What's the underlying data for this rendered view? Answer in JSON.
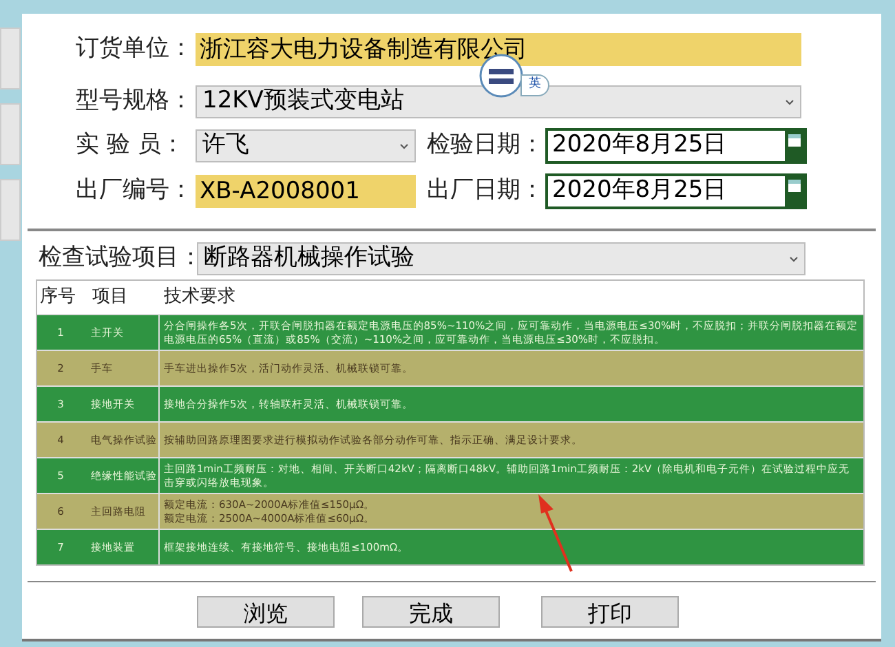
{
  "form": {
    "customer": {
      "label": "订货单位：",
      "value": "浙江容大电力设备制造有限公司"
    },
    "model": {
      "label": "型号规格：",
      "value": "12KV预装式变电站"
    },
    "tester": {
      "label": "实 验 员：",
      "value": "许飞"
    },
    "test_date": {
      "label": "检验日期：",
      "value": "2020年8月25日"
    },
    "serial": {
      "label": "出厂编号：",
      "value": "XB-A2008001"
    },
    "factory_date": {
      "label": "出厂日期：",
      "value": "2020年8月25日"
    }
  },
  "ime_badge": {
    "label": "英"
  },
  "test_item": {
    "label": "检查试验项目：",
    "value": "断路器机械操作试验"
  },
  "table": {
    "columns": [
      "序号",
      "项目",
      "技术要求"
    ],
    "rows": [
      {
        "no": "1",
        "item": "主开关",
        "color": "#2f9442",
        "lines": [
          "分合闸操作各5次，开联合闸脱扣器在额定电源电压的85%~110%之间，应可靠动作，当电源电压≤30%时，不应脱扣；并联分闸脱扣器在额定电源电压的65%（直流）或85%（交流）~110%之间，应可靠动作，当电源电压≤30%时，不应脱扣。"
        ]
      },
      {
        "no": "2",
        "item": "手车",
        "color": "#b5b06c",
        "lines": [
          "手车进出操作5次，活门动作灵活、机械联锁可靠。"
        ]
      },
      {
        "no": "3",
        "item": "接地开关",
        "color": "#2f9442",
        "lines": [
          "接地合分操作5次，转轴联杆灵活、机械联锁可靠。"
        ]
      },
      {
        "no": "4",
        "item": "电气操作试验",
        "color": "#b5b06c",
        "lines": [
          "按辅助回路原理图要求进行模拟动作试验各部分动作可靠、指示正确、满足设计要求。"
        ]
      },
      {
        "no": "5",
        "item": "绝缘性能试验",
        "color": "#2f9442",
        "lines": [
          "主回路1min工频耐压：对地、相间、开关断口42kV；隔离断口48kV。辅助回路1min工频耐压：2kV（除电机和电子元件）在试验过程中应无击穿或闪络放电现象。"
        ]
      },
      {
        "no": "6",
        "item": "主回路电阻",
        "color": "#b5b06c",
        "lines": [
          "额定电流：630A~2000A标准值≤150μΩ。",
          "额定电流：2500A~4000A标准值≤60μΩ。"
        ]
      },
      {
        "no": "7",
        "item": "接地装置",
        "color": "#2f9442",
        "lines": [
          "框架接地连续、有接地符号、接地电阻≤100mΩ。"
        ]
      }
    ]
  },
  "buttons": [
    "浏览",
    "完成",
    "打印"
  ]
}
